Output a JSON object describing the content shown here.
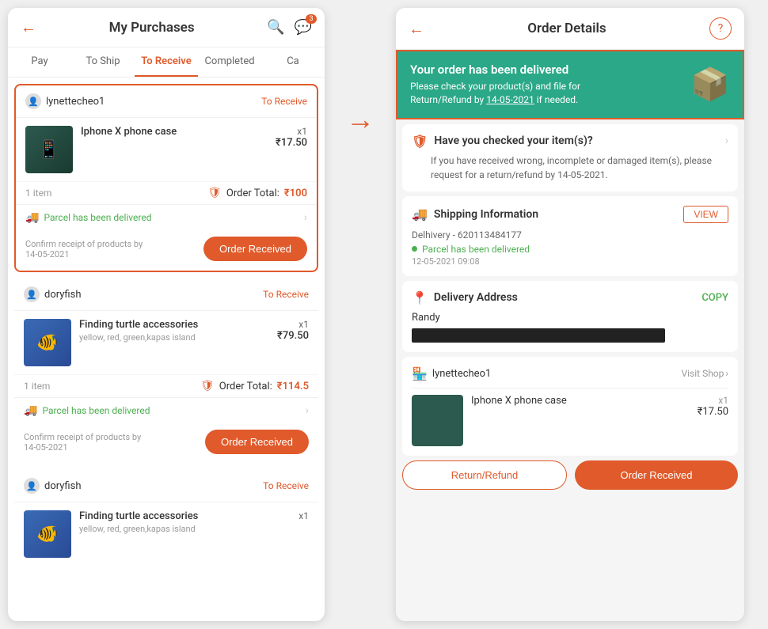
{
  "left": {
    "header": {
      "title": "My Purchases",
      "back_label": "←",
      "search_icon": "search",
      "chat_icon": "chat",
      "badge_count": "3"
    },
    "tabs": [
      {
        "label": "Pay",
        "active": false
      },
      {
        "label": "To Ship",
        "active": false
      },
      {
        "label": "To Receive",
        "active": true
      },
      {
        "label": "Completed",
        "active": false
      },
      {
        "label": "Ca",
        "active": false
      }
    ],
    "orders": [
      {
        "seller": "lynettecheo1",
        "status": "To Receive",
        "product_name": "Iphone X phone case",
        "product_variant": "",
        "qty": "x1",
        "price": "₹17.50",
        "items_count": "1 item",
        "order_total_label": "Order Total:",
        "order_total": "₹100",
        "delivery_status": "Parcel has been delivered",
        "confirm_text": "Confirm receipt of products by\n14-05-2021",
        "btn_label": "Order Received",
        "highlighted": true
      },
      {
        "seller": "doryfish",
        "status": "To Receive",
        "product_name": "Finding turtle accessories",
        "product_variant": "yellow, red, green,kapas island",
        "qty": "x1",
        "price": "₹79.50",
        "items_count": "1 item",
        "order_total_label": "Order Total:",
        "order_total": "₹114.5",
        "delivery_status": "Parcel has been delivered",
        "confirm_text": "Confirm receipt of products by\n14-05-2021",
        "btn_label": "Order Received",
        "highlighted": false
      },
      {
        "seller": "doryfish",
        "status": "To Receive",
        "product_name": "Finding turtle accessories",
        "product_variant": "yellow, red, green,kapas island",
        "qty": "x1",
        "price": "",
        "items_count": "",
        "order_total_label": "",
        "order_total": "",
        "delivery_status": "",
        "confirm_text": "",
        "btn_label": "",
        "highlighted": false,
        "partial": true
      }
    ]
  },
  "arrow": "→",
  "right": {
    "header": {
      "title": "Order Details",
      "back_label": "←",
      "help_icon": "?"
    },
    "banner": {
      "title": "Your order has been delivered",
      "subtitle": "Please check your product(s) and file for\nReturn/Refund by",
      "date_link": "14-05-2021",
      "subtitle_end": "if needed.",
      "icon": "📦"
    },
    "check_items": {
      "title": "Have you checked your item(s)?",
      "description": "If you have received wrong, incomplete or\ndamaged item(s), please request for a\nreturn/refund by 14-05-2021."
    },
    "shipping": {
      "section_title": "Shipping Information",
      "view_btn": "VIEW",
      "carrier": "Delhivery - 620113484177",
      "status": "Parcel has been delivered",
      "date": "12-05-2021 09:08"
    },
    "delivery_address": {
      "section_title": "Delivery Address",
      "copy_btn": "COPY",
      "name": "Randy",
      "address_redacted": true
    },
    "shop": {
      "name": "lynettecheo1",
      "visit_shop": "Visit Shop",
      "product_name": "Iphone X phone case",
      "qty": "x1",
      "price": "₹17.50"
    },
    "actions": {
      "return_btn": "Return/Refund",
      "received_btn": "Order Received"
    }
  }
}
